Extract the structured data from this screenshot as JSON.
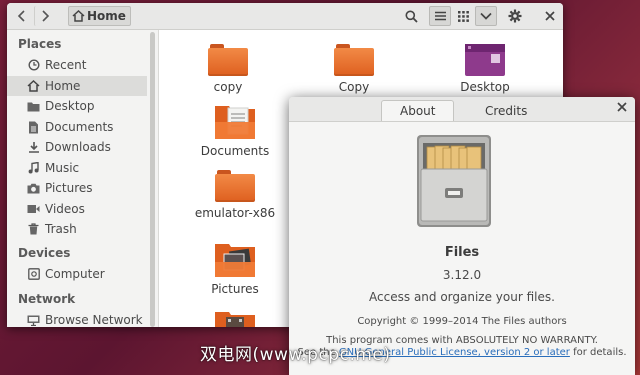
{
  "files": {
    "path_label": "Home",
    "icons": {
      "back": "chevron-left-icon",
      "forward": "chevron-right-icon",
      "home": "home-icon",
      "search": "search-icon",
      "list": "list-view-icon",
      "grid": "grid-view-icon",
      "menu": "chevron-down-icon",
      "settings": "gear-icon",
      "close": "close-icon"
    },
    "sidebar": {
      "places_label": "Places",
      "places": [
        {
          "label": "Recent",
          "icon": "clock-icon"
        },
        {
          "label": "Home",
          "icon": "home-icon",
          "active": true
        },
        {
          "label": "Desktop",
          "icon": "folder-icon"
        },
        {
          "label": "Documents",
          "icon": "document-icon"
        },
        {
          "label": "Downloads",
          "icon": "download-icon"
        },
        {
          "label": "Music",
          "icon": "music-icon"
        },
        {
          "label": "Pictures",
          "icon": "camera-icon"
        },
        {
          "label": "Videos",
          "icon": "video-icon"
        },
        {
          "label": "Trash",
          "icon": "trash-icon"
        }
      ],
      "devices_label": "Devices",
      "devices": [
        {
          "label": "Computer",
          "icon": "drive-icon"
        }
      ],
      "network_label": "Network",
      "network": [
        {
          "label": "Browse Network",
          "icon": "network-icon"
        }
      ]
    },
    "items": [
      {
        "name": "copy",
        "icon": "folder-icon"
      },
      {
        "name": "Copy",
        "icon": "folder-icon"
      },
      {
        "name": "Desktop",
        "icon": "desktop-folder-icon"
      },
      {
        "name": "Documents",
        "icon": "documents-folder-icon"
      },
      {
        "name": "emulator-x86",
        "icon": "folder-icon"
      },
      {
        "name": "Pictures",
        "icon": "pictures-folder-icon"
      }
    ]
  },
  "about": {
    "tabs": [
      "About",
      "Credits"
    ],
    "app_name": "Files",
    "version": "3.12.0",
    "description": "Access and organize your files.",
    "copyright": "Copyright © 1999–2014 The Files authors",
    "license_line1": "This program comes with ABSOLUTELY NO WARRANTY.",
    "license_line2_pre": "See the ",
    "license_link": "GNU General Public License, version 2 or later",
    "license_line2_post": " for details.",
    "icon": "file-cabinet-icon"
  },
  "watermark": "双电网(www.pcpc.me)",
  "colors": {
    "folder_orange": "#f07a36",
    "desktop_purple": "#8e3a8c",
    "link": "#2a6ebb",
    "wallpaper": "#6b1c36"
  }
}
